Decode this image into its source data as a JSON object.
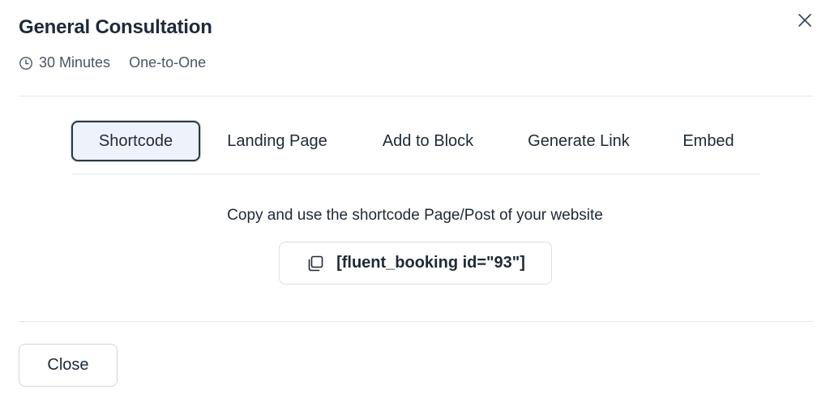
{
  "modal": {
    "title": "General Consultation",
    "duration": "30 Minutes",
    "event_type": "One-to-One"
  },
  "tabs": [
    {
      "label": "Shortcode",
      "active": true
    },
    {
      "label": "Landing Page",
      "active": false
    },
    {
      "label": "Add to Block",
      "active": false
    },
    {
      "label": "Generate Link",
      "active": false
    },
    {
      "label": "Embed",
      "active": false
    }
  ],
  "shortcode": {
    "instructions": "Copy and use the shortcode Page/Post of your website",
    "code": "[fluent_booking id=\"93\"]"
  },
  "footer": {
    "close_label": "Close"
  },
  "colors": {
    "active_tab_bg": "#eef3fb",
    "active_tab_border": "#2d3748",
    "divider": "#e5e7eb"
  },
  "icons": [
    "clock-icon",
    "close-icon",
    "copy-icon"
  ]
}
